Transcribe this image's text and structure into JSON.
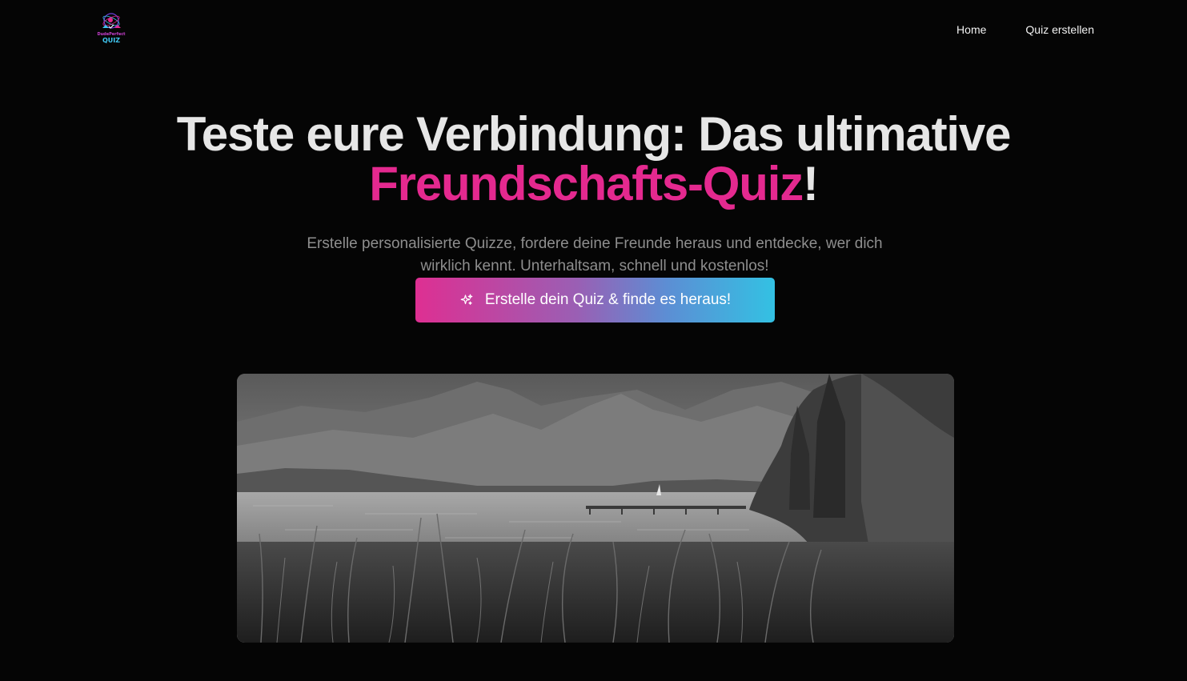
{
  "header": {
    "logo": {
      "icon": "quiz-logo-icon",
      "line1": "DudePerfect",
      "line2": "QUIZ"
    },
    "nav": [
      {
        "label": "Home"
      },
      {
        "label": "Quiz erstellen"
      }
    ]
  },
  "hero": {
    "title_part1": "Teste eure Verbindung: Das ultimative",
    "title_accent": "Freundschafts-Quiz",
    "title_end": "!",
    "subtitle": "Erstelle personalisierte Quizze, fordere deine Freunde heraus und entdecke, wer dich wirklich kennt. Unterhaltsam, schnell und kostenlos!",
    "cta_label": "Erstelle dein Quiz & finde es heraus!",
    "cta_icon": "sparkles-icon"
  },
  "colors": {
    "background": "#050505",
    "accent_pink": "#e4298f",
    "accent_cyan": "#33c1e3",
    "title_text": "#e6e6e6",
    "subtitle_text": "#8e8e8e"
  }
}
